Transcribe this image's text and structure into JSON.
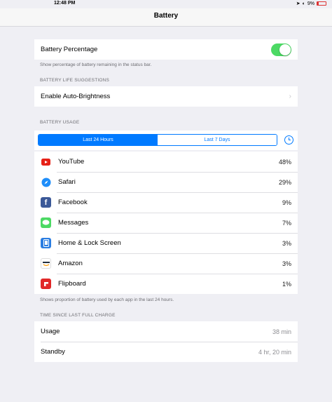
{
  "status_bar": {
    "time": "12:48 PM",
    "battery_text": "9%"
  },
  "nav": {
    "title": "Battery"
  },
  "battery_percentage": {
    "label": "Battery Percentage",
    "footer": "Show percentage of battery remaining in the status bar."
  },
  "suggestions": {
    "header": "BATTERY LIFE SUGGESTIONS",
    "item_label": "Enable Auto-Brightness"
  },
  "usage": {
    "header": "BATTERY USAGE",
    "segments": [
      "Last 24 Hours",
      "Last 7 Days"
    ],
    "apps": [
      {
        "name": "YouTube",
        "percent": "48%",
        "icon": "youtube-icon",
        "color": "#e62117"
      },
      {
        "name": "Safari",
        "percent": "29%",
        "icon": "safari-icon",
        "color": "#1f8efa"
      },
      {
        "name": "Facebook",
        "percent": "9%",
        "icon": "facebook-icon",
        "color": "#3b5998"
      },
      {
        "name": "Messages",
        "percent": "7%",
        "icon": "messages-icon",
        "color": "#4cd964"
      },
      {
        "name": "Home & Lock Screen",
        "percent": "3%",
        "icon": "home-lock-screen-icon",
        "color": "#2a7de1"
      },
      {
        "name": "Amazon",
        "percent": "3%",
        "icon": "amazon-icon",
        "color": "#232f3e"
      },
      {
        "name": "Flipboard",
        "percent": "1%",
        "icon": "flipboard-icon",
        "color": "#e12828"
      }
    ],
    "footer": "Shows proportion of battery used by each app in the last 24 hours."
  },
  "charge": {
    "header": "TIME SINCE LAST FULL CHARGE",
    "rows": [
      {
        "label": "Usage",
        "value": "38 min"
      },
      {
        "label": "Standby",
        "value": "4 hr, 20 min"
      }
    ]
  },
  "colors": {
    "accent": "#007aff",
    "toggle_on": "#4cd964",
    "background": "#efeff4"
  }
}
